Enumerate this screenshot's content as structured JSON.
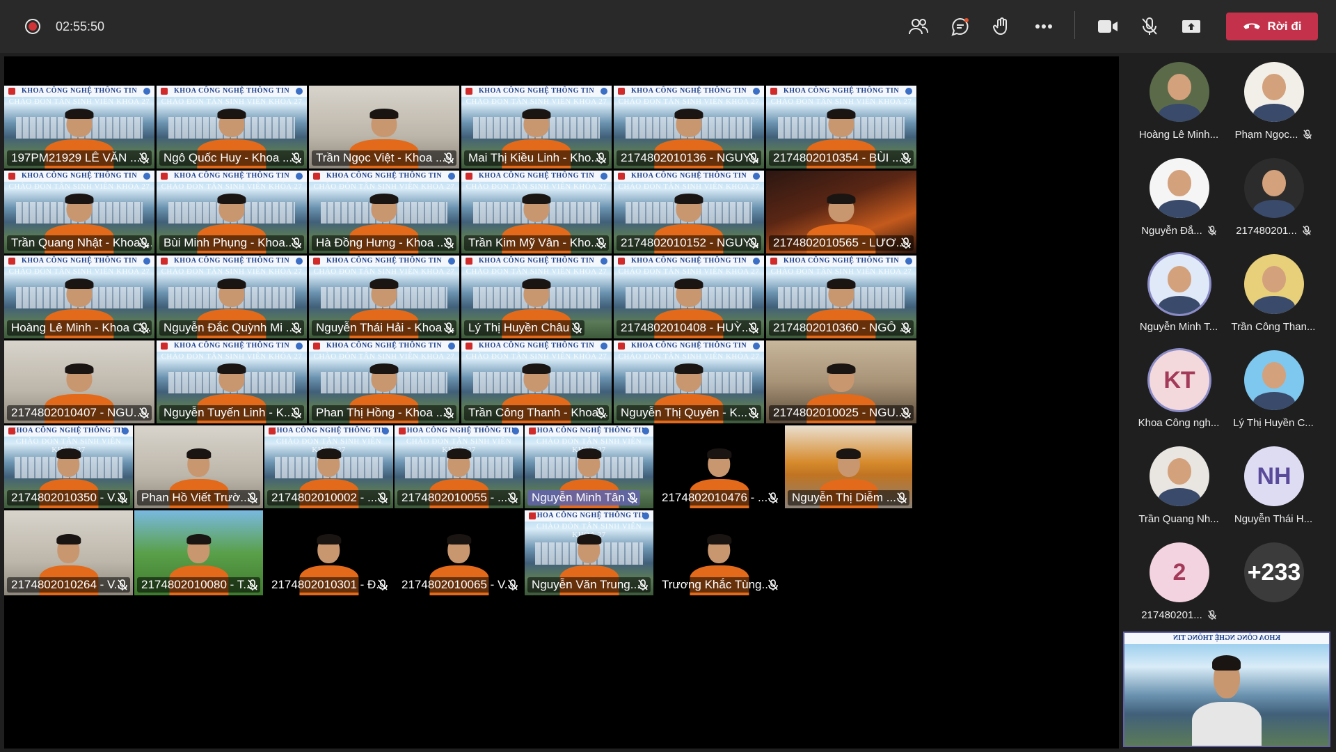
{
  "toolbar": {
    "timer": "02:55:50",
    "leave_label": "Rời đi",
    "icons": [
      "people-icon",
      "chat-icon",
      "raise-hand-icon",
      "more-icon",
      "camera-icon",
      "mic-off-icon",
      "share-icon"
    ]
  },
  "banner": {
    "line1": "KHOA CÔNG NGHỆ THÔNG TIN",
    "line2": "CHÀO ĐÓN TÂN SINH VIÊN KHÓA 27"
  },
  "tiles": [
    {
      "name": "197PM21929 LÊ VĂN ..."
    },
    {
      "name": "Ngô Quốc Huy - Khoa ..."
    },
    {
      "name": "Trần Ngọc Việt - Khoa ..."
    },
    {
      "name": "Mai Thị Kiều Linh - Kho..."
    },
    {
      "name": "2174802010136 - NGUY..."
    },
    {
      "name": "2174802010354 - BÙI ..."
    },
    {
      "name": "Trần Quang Nhật - Khoa ..."
    },
    {
      "name": "Bùi Minh Phụng - Khoa..."
    },
    {
      "name": "Hà Đồng Hưng - Khoa ..."
    },
    {
      "name": "Trần Kim Mỹ Vân - Kho..."
    },
    {
      "name": "2174802010152 - NGUY..."
    },
    {
      "name": "2174802010565 - LƯƠ..."
    },
    {
      "name": "Hoàng Lê Minh - Khoa C..."
    },
    {
      "name": "Nguyễn Đắc Quỳnh Mi ..."
    },
    {
      "name": "Nguyễn Thái Hải - Khoa ..."
    },
    {
      "name": "Lý Thị Huyền Châu"
    },
    {
      "name": "2174802010408 - HUỲ..."
    },
    {
      "name": "2174802010360 - NGÔ ..."
    },
    {
      "name": "2174802010407 - NGU..."
    },
    {
      "name": "Nguyễn Tuyến Linh - K..."
    },
    {
      "name": "Phan Thị Hồng - Khoa ..."
    },
    {
      "name": "Trần Công Thanh - Khoa ..."
    },
    {
      "name": "Nguyễn Thị Quyên - K..."
    },
    {
      "name": "2174802010025 - NGU..."
    },
    {
      "name": "2174802010350 - V..."
    },
    {
      "name": "Phan Hồ Viết Trườ..."
    },
    {
      "name": "2174802010002 - ..."
    },
    {
      "name": "2174802010055 - ..."
    },
    {
      "name": "Nguyễn Minh Tân"
    },
    {
      "name": "2174802010476 - ..."
    },
    {
      "name": "Nguyễn Thị Diễm ..."
    },
    {
      "name": "2174802010264 - V..."
    },
    {
      "name": "2174802010080 - T..."
    },
    {
      "name": "2174802010301 - Đ..."
    },
    {
      "name": "2174802010065 - V..."
    },
    {
      "name": "Nguyễn Văn Trung..."
    },
    {
      "name": "Trương Khắc Tùng..."
    }
  ],
  "sidebar": {
    "participants": [
      {
        "label": "Hoàng Lê Minh...",
        "initials": "",
        "bg": "#5b6b4a",
        "muted": false
      },
      {
        "label": "Phạm Ngọc...",
        "initials": "",
        "bg": "#f2efe9",
        "muted": true
      },
      {
        "label": "Nguyễn Đắ...",
        "initials": "",
        "bg": "#f5f5f5",
        "muted": true
      },
      {
        "label": "217480201...",
        "initials": "",
        "bg": "#2c2c2c",
        "muted": true
      },
      {
        "label": "Nguyễn Minh T...",
        "initials": "",
        "bg": "#dfe9f7",
        "muted": false
      },
      {
        "label": "Trần Công Than...",
        "initials": "",
        "bg": "#e8d07a",
        "muted": false
      },
      {
        "label": "Khoa Công ngh...",
        "initials": "KT",
        "bg": "#f3d9dc",
        "muted": false
      },
      {
        "label": "Lý Thị Huyền C...",
        "initials": "",
        "bg": "#7ec8f0",
        "muted": false
      },
      {
        "label": "Trần Quang Nh...",
        "initials": "",
        "bg": "#e9e6e1",
        "muted": false
      },
      {
        "label": "Nguyễn Thái H...",
        "initials": "NH",
        "bg": "#dedcf3",
        "muted": false
      },
      {
        "label": "217480201...",
        "initials": "2",
        "bg": "#f3d3df",
        "muted": true
      },
      {
        "label": "",
        "initials": "+233",
        "bg": "#3b3b3b",
        "muted": false
      }
    ]
  }
}
